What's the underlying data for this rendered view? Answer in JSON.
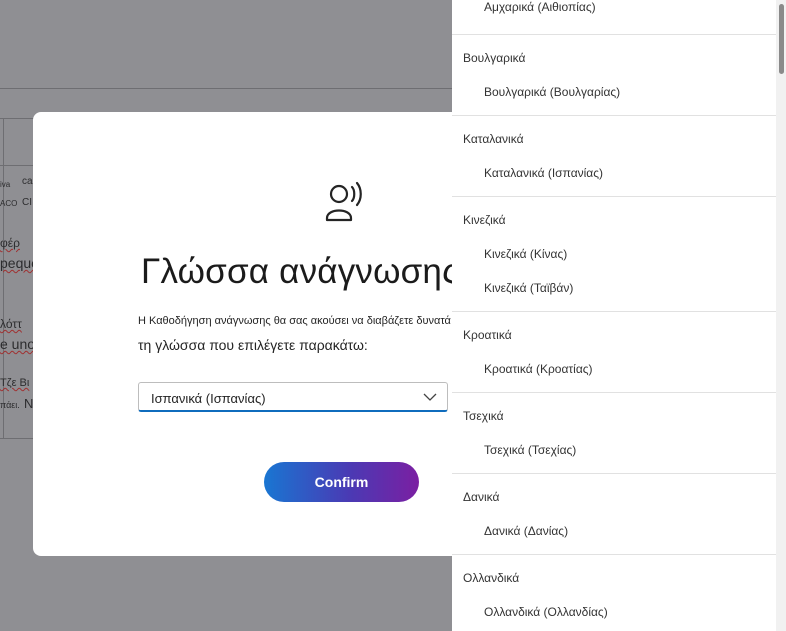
{
  "background": {
    "fragments": [
      {
        "text": "iva",
        "squiggle": false
      },
      {
        "text": "ca",
        "squiggle": false
      },
      {
        "text": "ACO",
        "squiggle": false
      },
      {
        "text": "CI",
        "squiggle": false
      },
      {
        "text": "φέρ",
        "squiggle": true
      },
      {
        "text": "peque",
        "squiggle": true
      },
      {
        "text": "λόττ",
        "squiggle": true
      },
      {
        "text": "e uno",
        "squiggle": true
      },
      {
        "text": "Τζε Βι",
        "squiggle": true
      },
      {
        "text": "πάει.",
        "squiggle": false
      },
      {
        "text": "N",
        "squiggle": false
      }
    ]
  },
  "dialog": {
    "icon": "person-speaking-icon",
    "title": "Γλώσσα ανάγνωσης",
    "description_line1": "Η Καθοδήγηση ανάγνωσης θα σας ακούσει να διαβάζετε δυνατά",
    "description_line2": "τη γλώσσα που επιλέγετε παρακάτω:",
    "selected_language": "Ισπανικά (Ισπανίας)",
    "dropdown_icon": "chevron-down-icon",
    "confirm_label": "Confirm",
    "colors": {
      "accent": "#0f6cbd",
      "button_start": "#1976d2",
      "button_end": "#7b1fa2"
    }
  },
  "language_list": {
    "groups": [
      {
        "header": "",
        "options": [
          "Αμχαρικά (Αιθιοπίας)"
        ]
      },
      {
        "header": "Βουλγαρικά",
        "options": [
          "Βουλγαρικά (Βουλγαρίας)"
        ]
      },
      {
        "header": "Καταλανικά",
        "options": [
          "Καταλανικά (Ισπανίας)"
        ]
      },
      {
        "header": "Κινεζικά",
        "options": [
          "Κινεζικά (Κίνας)",
          "Κινεζικά (Ταϊβάν)"
        ]
      },
      {
        "header": "Κροατικά",
        "options": [
          "Κροατικά (Κροατίας)"
        ]
      },
      {
        "header": "Τσεχικά",
        "options": [
          "Τσεχικά (Τσεχίας)"
        ]
      },
      {
        "header": "Δανικά",
        "options": [
          "Δανικά (Δανίας)"
        ]
      },
      {
        "header": "Ολλανδικά",
        "options": [
          "Ολλανδικά (Ολλανδίας)"
        ]
      }
    ]
  }
}
